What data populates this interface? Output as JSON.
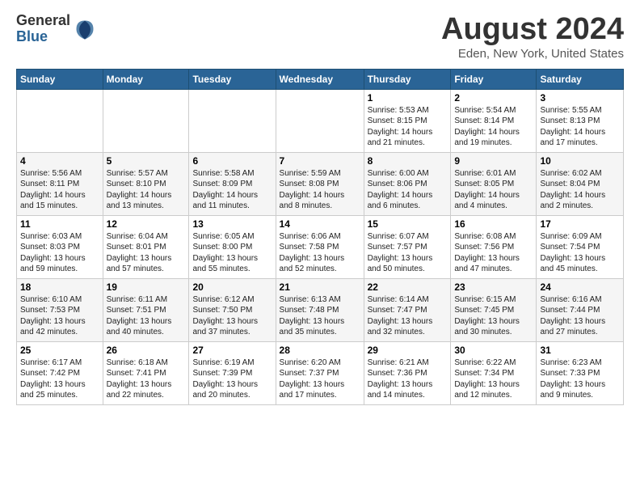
{
  "header": {
    "logo_general": "General",
    "logo_blue": "Blue",
    "month_title": "August 2024",
    "location": "Eden, New York, United States"
  },
  "calendar": {
    "days_of_week": [
      "Sunday",
      "Monday",
      "Tuesday",
      "Wednesday",
      "Thursday",
      "Friday",
      "Saturday"
    ],
    "weeks": [
      [
        {
          "day": "",
          "info": ""
        },
        {
          "day": "",
          "info": ""
        },
        {
          "day": "",
          "info": ""
        },
        {
          "day": "",
          "info": ""
        },
        {
          "day": "1",
          "info": "Sunrise: 5:53 AM\nSunset: 8:15 PM\nDaylight: 14 hours\nand 21 minutes."
        },
        {
          "day": "2",
          "info": "Sunrise: 5:54 AM\nSunset: 8:14 PM\nDaylight: 14 hours\nand 19 minutes."
        },
        {
          "day": "3",
          "info": "Sunrise: 5:55 AM\nSunset: 8:13 PM\nDaylight: 14 hours\nand 17 minutes."
        }
      ],
      [
        {
          "day": "4",
          "info": "Sunrise: 5:56 AM\nSunset: 8:11 PM\nDaylight: 14 hours\nand 15 minutes."
        },
        {
          "day": "5",
          "info": "Sunrise: 5:57 AM\nSunset: 8:10 PM\nDaylight: 14 hours\nand 13 minutes."
        },
        {
          "day": "6",
          "info": "Sunrise: 5:58 AM\nSunset: 8:09 PM\nDaylight: 14 hours\nand 11 minutes."
        },
        {
          "day": "7",
          "info": "Sunrise: 5:59 AM\nSunset: 8:08 PM\nDaylight: 14 hours\nand 8 minutes."
        },
        {
          "day": "8",
          "info": "Sunrise: 6:00 AM\nSunset: 8:06 PM\nDaylight: 14 hours\nand 6 minutes."
        },
        {
          "day": "9",
          "info": "Sunrise: 6:01 AM\nSunset: 8:05 PM\nDaylight: 14 hours\nand 4 minutes."
        },
        {
          "day": "10",
          "info": "Sunrise: 6:02 AM\nSunset: 8:04 PM\nDaylight: 14 hours\nand 2 minutes."
        }
      ],
      [
        {
          "day": "11",
          "info": "Sunrise: 6:03 AM\nSunset: 8:03 PM\nDaylight: 13 hours\nand 59 minutes."
        },
        {
          "day": "12",
          "info": "Sunrise: 6:04 AM\nSunset: 8:01 PM\nDaylight: 13 hours\nand 57 minutes."
        },
        {
          "day": "13",
          "info": "Sunrise: 6:05 AM\nSunset: 8:00 PM\nDaylight: 13 hours\nand 55 minutes."
        },
        {
          "day": "14",
          "info": "Sunrise: 6:06 AM\nSunset: 7:58 PM\nDaylight: 13 hours\nand 52 minutes."
        },
        {
          "day": "15",
          "info": "Sunrise: 6:07 AM\nSunset: 7:57 PM\nDaylight: 13 hours\nand 50 minutes."
        },
        {
          "day": "16",
          "info": "Sunrise: 6:08 AM\nSunset: 7:56 PM\nDaylight: 13 hours\nand 47 minutes."
        },
        {
          "day": "17",
          "info": "Sunrise: 6:09 AM\nSunset: 7:54 PM\nDaylight: 13 hours\nand 45 minutes."
        }
      ],
      [
        {
          "day": "18",
          "info": "Sunrise: 6:10 AM\nSunset: 7:53 PM\nDaylight: 13 hours\nand 42 minutes."
        },
        {
          "day": "19",
          "info": "Sunrise: 6:11 AM\nSunset: 7:51 PM\nDaylight: 13 hours\nand 40 minutes."
        },
        {
          "day": "20",
          "info": "Sunrise: 6:12 AM\nSunset: 7:50 PM\nDaylight: 13 hours\nand 37 minutes."
        },
        {
          "day": "21",
          "info": "Sunrise: 6:13 AM\nSunset: 7:48 PM\nDaylight: 13 hours\nand 35 minutes."
        },
        {
          "day": "22",
          "info": "Sunrise: 6:14 AM\nSunset: 7:47 PM\nDaylight: 13 hours\nand 32 minutes."
        },
        {
          "day": "23",
          "info": "Sunrise: 6:15 AM\nSunset: 7:45 PM\nDaylight: 13 hours\nand 30 minutes."
        },
        {
          "day": "24",
          "info": "Sunrise: 6:16 AM\nSunset: 7:44 PM\nDaylight: 13 hours\nand 27 minutes."
        }
      ],
      [
        {
          "day": "25",
          "info": "Sunrise: 6:17 AM\nSunset: 7:42 PM\nDaylight: 13 hours\nand 25 minutes."
        },
        {
          "day": "26",
          "info": "Sunrise: 6:18 AM\nSunset: 7:41 PM\nDaylight: 13 hours\nand 22 minutes."
        },
        {
          "day": "27",
          "info": "Sunrise: 6:19 AM\nSunset: 7:39 PM\nDaylight: 13 hours\nand 20 minutes."
        },
        {
          "day": "28",
          "info": "Sunrise: 6:20 AM\nSunset: 7:37 PM\nDaylight: 13 hours\nand 17 minutes."
        },
        {
          "day": "29",
          "info": "Sunrise: 6:21 AM\nSunset: 7:36 PM\nDaylight: 13 hours\nand 14 minutes."
        },
        {
          "day": "30",
          "info": "Sunrise: 6:22 AM\nSunset: 7:34 PM\nDaylight: 13 hours\nand 12 minutes."
        },
        {
          "day": "31",
          "info": "Sunrise: 6:23 AM\nSunset: 7:33 PM\nDaylight: 13 hours\nand 9 minutes."
        }
      ]
    ]
  }
}
